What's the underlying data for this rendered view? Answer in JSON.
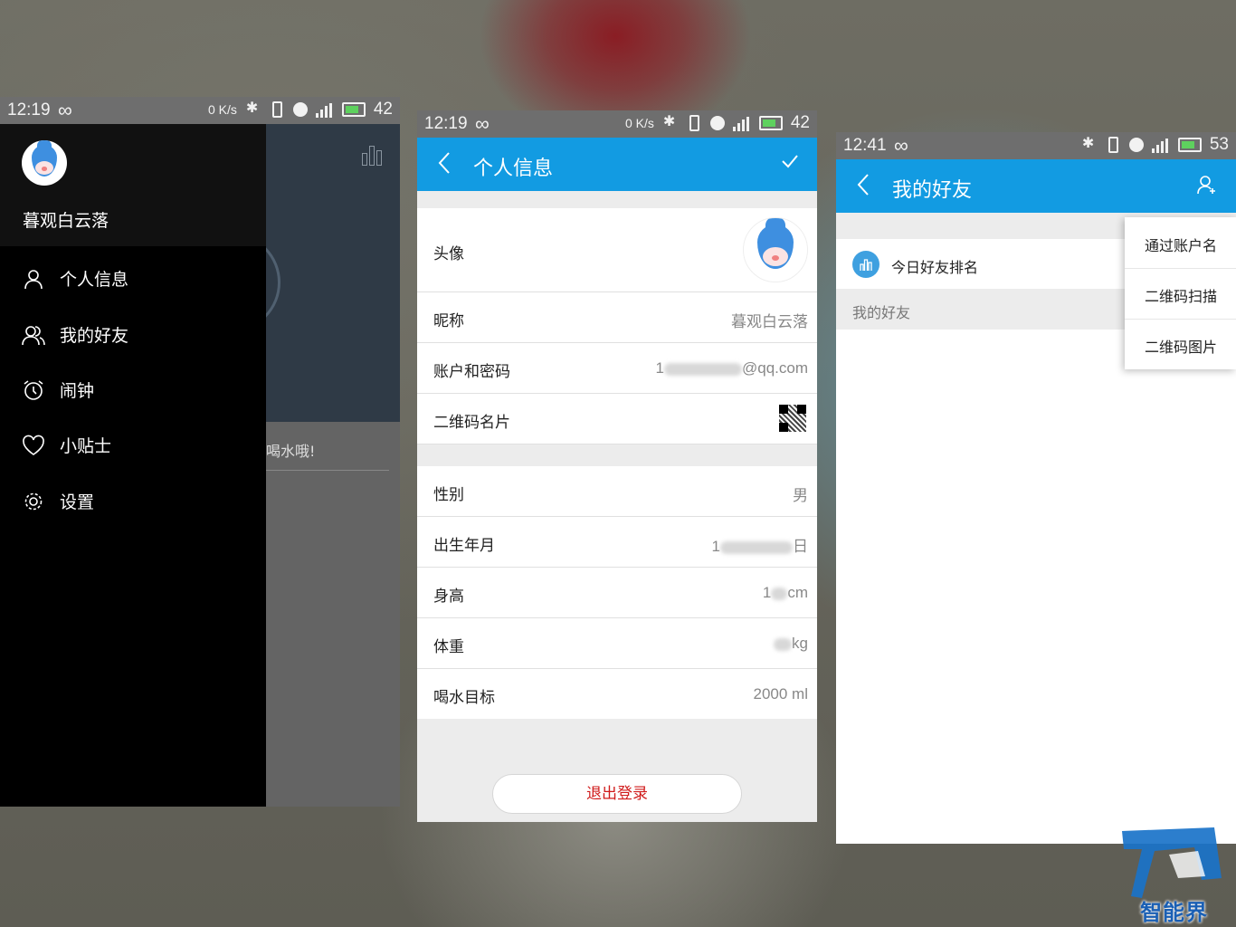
{
  "screen1": {
    "status": {
      "time": "12:19",
      "speed": "0 K/s",
      "battery": "42"
    },
    "username": "暮观白云落",
    "background_tip": "喝水哦!",
    "menu": [
      {
        "label": "个人信息",
        "icon": "person-icon"
      },
      {
        "label": "我的好友",
        "icon": "friends-icon"
      },
      {
        "label": "闹钟",
        "icon": "alarm-clock-icon"
      },
      {
        "label": "小贴士",
        "icon": "heart-icon"
      },
      {
        "label": "设置",
        "icon": "gear-icon"
      }
    ]
  },
  "screen2": {
    "status": {
      "time": "12:19",
      "speed": "0 K/s",
      "battery": "42"
    },
    "title": "个人信息",
    "rows": {
      "avatar": "头像",
      "nickname": {
        "label": "昵称",
        "value": "暮观白云落"
      },
      "account": {
        "label": "账户和密码",
        "value_prefix": "1",
        "value_suffix": "@qq.com"
      },
      "qrcard": "二维码名片",
      "gender": {
        "label": "性别",
        "value": "男"
      },
      "birth": {
        "label": "出生年月",
        "value_prefix": "1",
        "value_suffix": "日"
      },
      "height": {
        "label": "身高",
        "value_prefix": "1",
        "value_suffix": "cm"
      },
      "weight": {
        "label": "体重",
        "value_suffix": "kg"
      },
      "goal": {
        "label": "喝水目标",
        "value": "2000 ml"
      }
    },
    "logout": "退出登录"
  },
  "screen3": {
    "status": {
      "time": "12:41",
      "battery": "53"
    },
    "title": "我的好友",
    "ranking": "今日好友排名",
    "section": "我的好友",
    "popup": [
      "通过账户名",
      "二维码扫描",
      "二维码图片"
    ]
  },
  "watermark": {
    "brand": "智能界"
  },
  "colors": {
    "accent": "#129be2",
    "logout": "#d01b1b"
  }
}
